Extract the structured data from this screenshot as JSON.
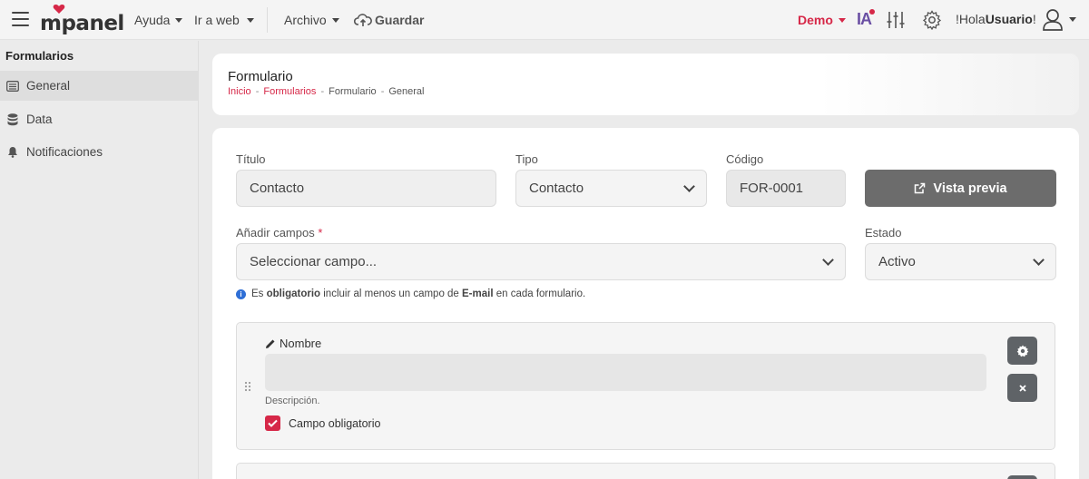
{
  "topbar": {
    "logo_text": "mpanel",
    "menu": [
      {
        "label": "Ayuda"
      },
      {
        "label": "Ir a web"
      },
      {
        "label": "Archivo"
      }
    ],
    "save_label": "Guardar",
    "demo_label": "Demo",
    "ia_label": "IA",
    "greeting_prefix": "!Hola ",
    "greeting_user": "Usuario",
    "greeting_suffix": "!"
  },
  "sidebar": {
    "title": "Formularios",
    "items": [
      {
        "label": "General",
        "icon": "list-icon",
        "active": true
      },
      {
        "label": "Data",
        "icon": "database-icon",
        "active": false
      },
      {
        "label": "Notificaciones",
        "icon": "bell-icon",
        "active": false
      }
    ]
  },
  "header": {
    "title": "Formulario",
    "breadcrumb": [
      "Inicio",
      "Formularios",
      "Formulario",
      "General"
    ],
    "separator": "-"
  },
  "form": {
    "titulo_label": "Título",
    "titulo_value": "Contacto",
    "tipo_label": "Tipo",
    "tipo_value": "Contacto",
    "codigo_label": "Código",
    "codigo_value": "FOR-0001",
    "preview_label": "Vista previa",
    "anadir_label": "Añadir campos",
    "required_mark": "*",
    "anadir_value": "Seleccionar campo...",
    "estado_label": "Estado",
    "estado_value": "Activo",
    "info_pre": "Es ",
    "info_b1": "obligatorio",
    "info_mid": " incluir al menos un campo de ",
    "info_b2": "E-mail",
    "info_post": " en cada formulario."
  },
  "field_block": {
    "label": "Nombre",
    "description": "Descripción.",
    "required_label": "Campo obligatorio",
    "required_checked": true
  },
  "colors": {
    "accent": "#d62848",
    "button_gray": "#6c6c6c",
    "info_blue": "#2f6fd6"
  }
}
